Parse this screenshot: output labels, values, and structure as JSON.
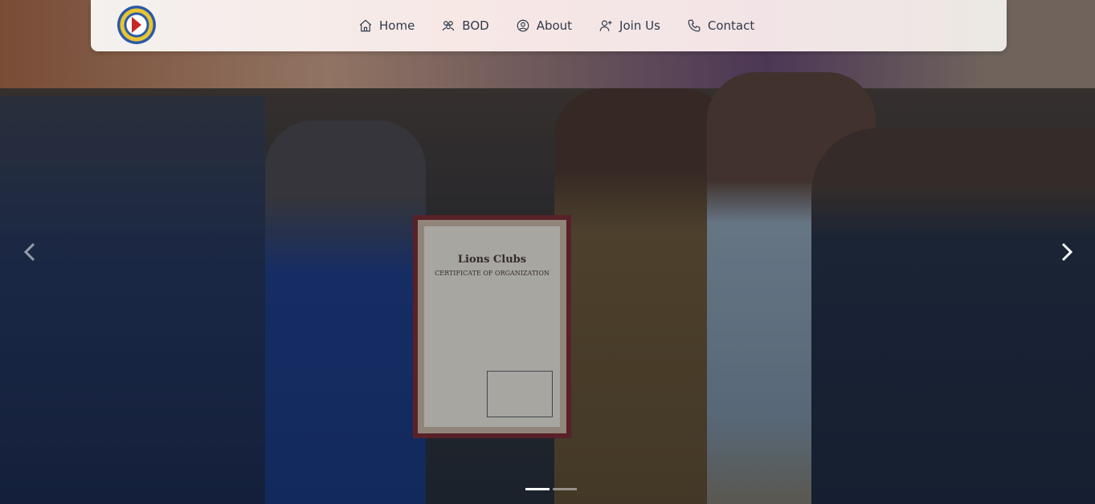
{
  "brand": {
    "logo_name": "club-emblem"
  },
  "nav": {
    "items": [
      {
        "label": "Home",
        "icon": "home-icon"
      },
      {
        "label": "BOD",
        "icon": "group-icon"
      },
      {
        "label": "About",
        "icon": "user-circle-icon"
      },
      {
        "label": "Join Us",
        "icon": "user-plus-icon"
      },
      {
        "label": "Contact",
        "icon": "phone-icon"
      }
    ]
  },
  "carousel": {
    "slide_count": 2,
    "active_slide": 1,
    "prev_icon": "chevron-left-icon",
    "next_icon": "chevron-right-icon"
  },
  "certificate": {
    "title": "Lions Clubs",
    "subtitle": "CERTIFICATE OF ORGANIZATION"
  },
  "colors": {
    "navbar_bg": "#f4ecea",
    "nav_text": "#2f3a4a",
    "indicator_active": "#ffffff"
  }
}
